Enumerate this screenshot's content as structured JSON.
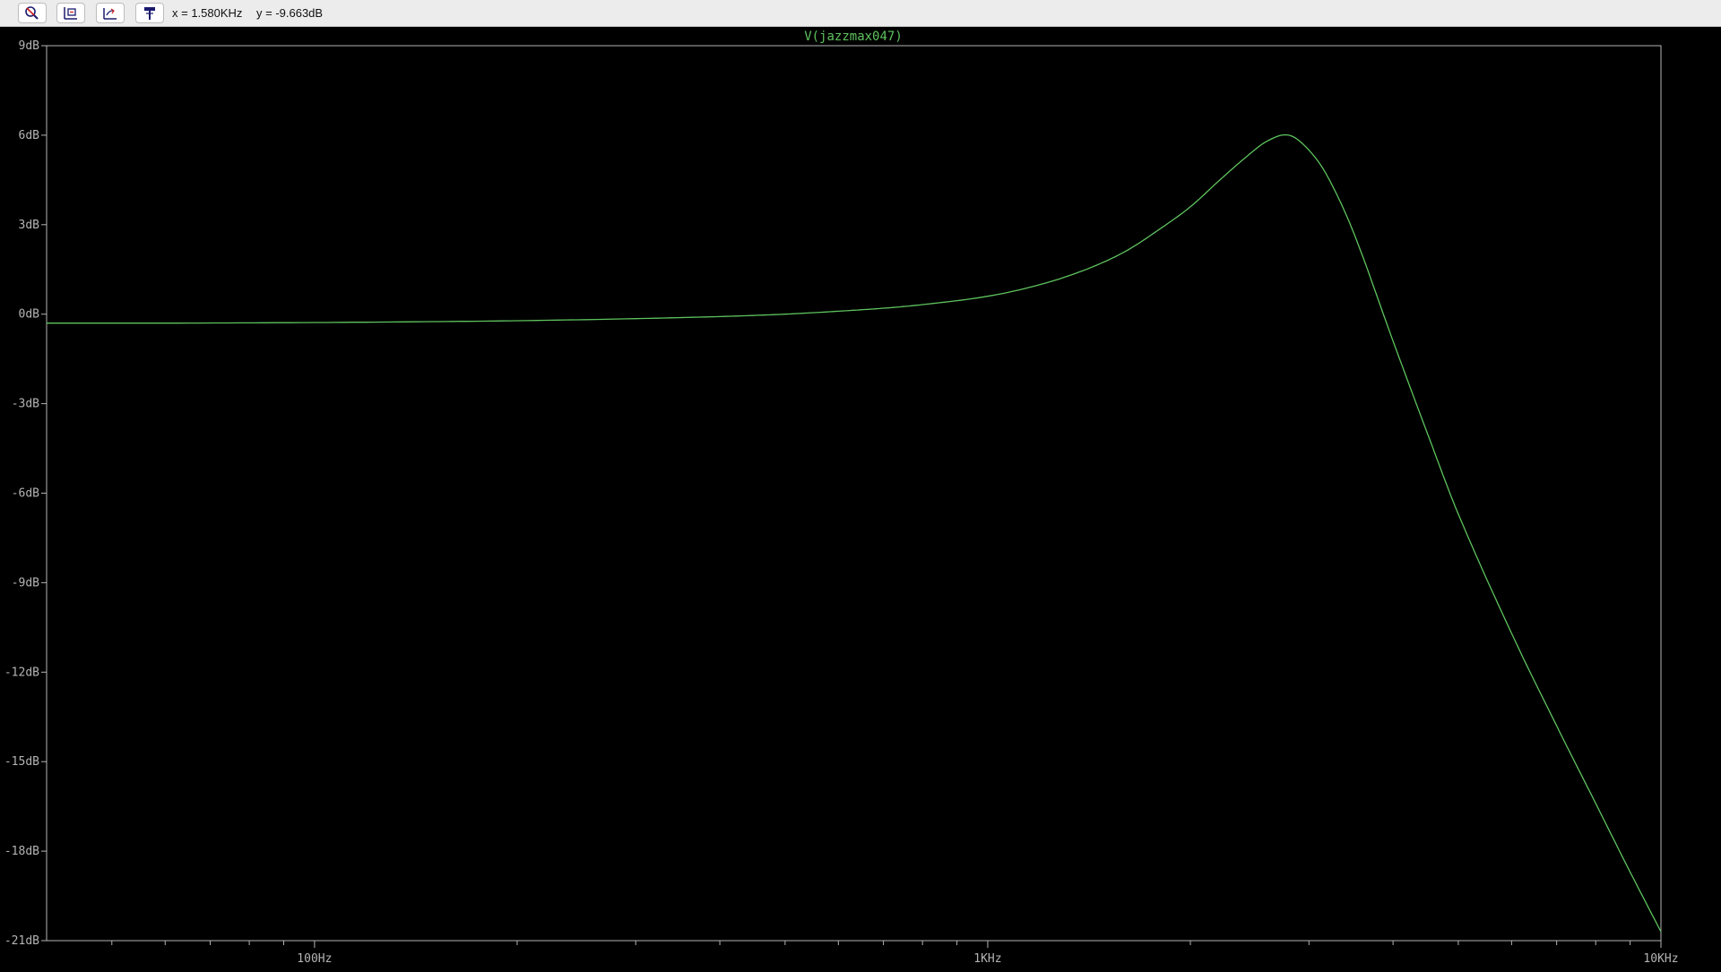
{
  "toolbar": {
    "buttons": [
      {
        "name": "zoom-area-button",
        "icon": "magnifier-zoom-icon"
      },
      {
        "name": "zoom-extents-button",
        "icon": "zoom-extents-icon"
      },
      {
        "name": "pan-axis-button",
        "icon": "axis-pan-icon"
      },
      {
        "name": "probe-button",
        "icon": "probe-icon"
      }
    ],
    "cursor_x": "x = 1.580KHz",
    "cursor_y": "y = -9.663dB"
  },
  "colors": {
    "trace": "#5ec35e",
    "axis": "#b4b4b4",
    "tick_text": "#b4b4b4",
    "background": "#000000"
  },
  "chart_data": {
    "type": "line",
    "title": "V(jazzmax047)",
    "x_scale": "log",
    "xlim": [
      40,
      10000
    ],
    "ylim": [
      -21,
      9
    ],
    "y_ticks": [
      {
        "value": 9,
        "label": "9dB"
      },
      {
        "value": 6,
        "label": "6dB"
      },
      {
        "value": 3,
        "label": "3dB"
      },
      {
        "value": 0,
        "label": "0dB"
      },
      {
        "value": -3,
        "label": "-3dB"
      },
      {
        "value": -6,
        "label": "-6dB"
      },
      {
        "value": -9,
        "label": "-9dB"
      },
      {
        "value": -12,
        "label": "-12dB"
      },
      {
        "value": -15,
        "label": "-15dB"
      },
      {
        "value": -18,
        "label": "-18dB"
      },
      {
        "value": -21,
        "label": "-21dB"
      }
    ],
    "x_ticks_major": [
      {
        "value": 100,
        "label": "100Hz"
      },
      {
        "value": 1000,
        "label": "1KHz"
      },
      {
        "value": 10000,
        "label": "10KHz"
      }
    ],
    "x_ticks_minor": [
      50,
      60,
      70,
      80,
      90,
      200,
      300,
      400,
      500,
      600,
      700,
      800,
      900,
      2000,
      3000,
      4000,
      5000,
      6000,
      7000,
      8000,
      9000
    ],
    "series": [
      {
        "name": "V(jazzmax047)",
        "x": [
          40,
          60,
          100,
          150,
          200,
          300,
          400,
          500,
          600,
          700,
          800,
          1000,
          1200,
          1400,
          1600,
          1800,
          2000,
          2200,
          2400,
          2600,
          2800,
          3000,
          3200,
          3500,
          4000,
          4500,
          5000,
          6000,
          7000,
          8000,
          9000,
          10000
        ],
        "y": [
          -0.3,
          -0.3,
          -0.28,
          -0.25,
          -0.22,
          -0.15,
          -0.08,
          0.0,
          0.1,
          0.2,
          0.32,
          0.6,
          1.0,
          1.5,
          2.1,
          2.85,
          3.6,
          4.45,
          5.2,
          5.8,
          6.0,
          5.5,
          4.6,
          2.7,
          -0.9,
          -4.0,
          -6.7,
          -10.7,
          -13.8,
          -16.4,
          -18.7,
          -20.7
        ]
      }
    ]
  }
}
